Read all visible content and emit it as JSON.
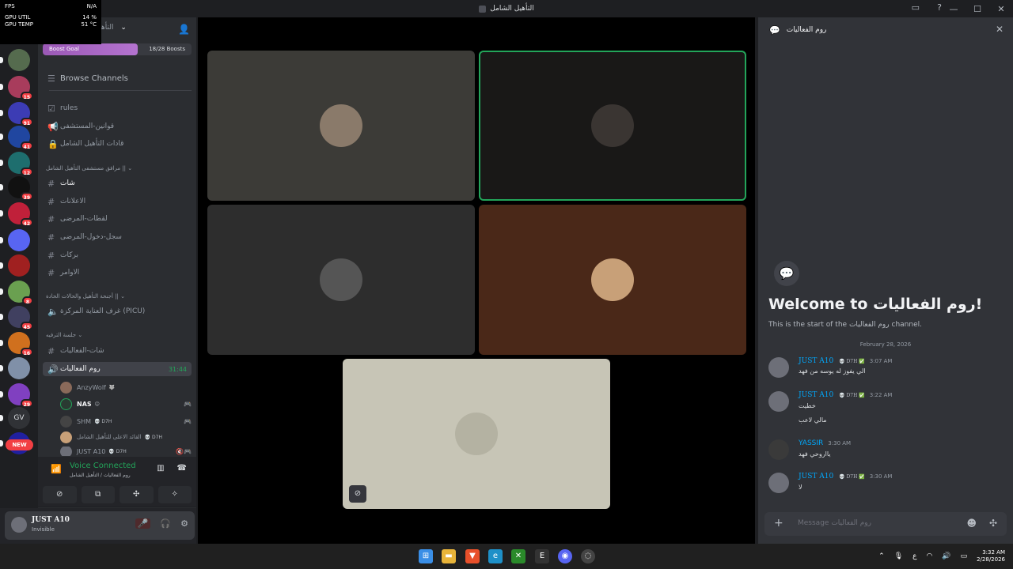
{
  "perf": {
    "fps_label": "FPS",
    "fps_value": "N/A",
    "gpu_util_label": "GPU UTIL",
    "gpu_util_value": "14 %",
    "gpu_temp_label": "GPU TEMP",
    "gpu_temp_value": "51 °C"
  },
  "window": {
    "title": "التأهيل الشامل"
  },
  "server": {
    "name": "التأهيل الشامل"
  },
  "boost": {
    "label": "Boost Goal",
    "count": "18/28 Boosts",
    "progress": 0.64
  },
  "sidebar": {
    "browse": "Browse Channels",
    "channels": [
      {
        "label": "rules"
      },
      {
        "label": "قوانين-المستشفى"
      },
      {
        "label": "قادات التأهيل الشامل"
      }
    ],
    "category1": "مرافق مستشفى التأهيل الشامل ||",
    "text_channels": [
      {
        "label": "شات"
      },
      {
        "label": "الاعلانات"
      },
      {
        "label": "لقطات-المرضى"
      },
      {
        "label": "سجل-دخول-المرضى"
      },
      {
        "label": "بركات"
      },
      {
        "label": "الاوامر"
      }
    ],
    "category2": "أجنحة التأهيل والحالات الحادة ||",
    "picu": "غرف العناية المركزة (PICU)",
    "category3": "جلسة الترفيه",
    "chat_events": "شات-الفعاليات",
    "voice_channel": {
      "label": "روم الفعاليات",
      "timer": "31:44"
    },
    "voice_users": [
      {
        "name": "AnzyWolf",
        "tag": "🐺",
        "right": ""
      },
      {
        "name": "NAS",
        "tag": "😊",
        "right": "🎮"
      },
      {
        "name": "SHM",
        "tag": "💀 D7H",
        "right": "🎮"
      },
      {
        "name": "القائد الاعلى للتأهيل الشامل",
        "tag": "💀 D7H",
        "right": ""
      },
      {
        "name": "JUST A10",
        "tag": "💀 D7H",
        "right": "🔇🎮"
      }
    ]
  },
  "servers": [
    {
      "badge": "",
      "color": "#556b4e"
    },
    {
      "badge": "15",
      "color": "#a83c5c"
    },
    {
      "badge": "91",
      "color": "#3c3cb4"
    },
    {
      "badge": "41",
      "color": "#2046a0"
    },
    {
      "badge": "12",
      "color": "#1e6e6e"
    },
    {
      "badge": "39",
      "color": "#111111"
    },
    {
      "badge": "42",
      "color": "#c0203a"
    },
    {
      "badge": "",
      "color": "#5865f2"
    },
    {
      "badge": "",
      "color": "#a02020"
    },
    {
      "badge": "8",
      "color": "#6aa050"
    },
    {
      "badge": "45",
      "color": "#404060"
    },
    {
      "badge": "16",
      "color": "#d0701e"
    },
    {
      "badge": "",
      "color": "#8090a8"
    },
    {
      "badge": "29",
      "color": "#8040c0"
    },
    {
      "badge": "",
      "color": "#303236"
    },
    {
      "badge": "",
      "color": "#2020a0"
    }
  ],
  "new_label": "NEW",
  "gv_label": "GV",
  "voice_panel": {
    "status": "Voice Connected",
    "channel": "روم الفعاليات / التأهيل الشامل"
  },
  "user": {
    "name": "JUST A10",
    "status": "Invisible"
  },
  "stage_tiles": [
    {
      "bg": "#3c3b37",
      "speaking": false,
      "avatar": "#8a7a6a"
    },
    {
      "bg": "#191817",
      "speaking": true,
      "avatar": "#3a3532"
    },
    {
      "bg": "#2d2d2d",
      "speaking": false,
      "avatar": "#555555"
    },
    {
      "bg": "#4a2818",
      "speaking": false,
      "avatar": "#c8a078"
    },
    {
      "bg": "#c7c5b6",
      "speaking": false,
      "avatar": "#b4b2a2"
    }
  ],
  "chat": {
    "header": "روم الفعاليات",
    "welcome_prefix": "Welcome to",
    "welcome_name": "روم الفعاليات!",
    "start_prefix": "This is the start of the",
    "start_channel": "روم الفعاليات",
    "start_suffix": "channel.",
    "date": "February 28, 2026",
    "messages": [
      {
        "author": "JUST A10",
        "tag": "💀 D7H ✅",
        "time": "3:07 AM",
        "lines": [
          "الي يفوز له يوسه من فهد"
        ]
      },
      {
        "author": "JUST A10",
        "tag": "💀 D7H ✅",
        "time": "3:22 AM",
        "lines": [
          "خطيت",
          "مالي لاعب"
        ]
      },
      {
        "author": "YASSIR",
        "tag": "",
        "time": "3:30 AM",
        "lines": [
          "يااروحي فهد"
        ]
      },
      {
        "author": "JUST A10",
        "tag": "💀 D7H ✅",
        "time": "3:30 AM",
        "lines": [
          "لا"
        ]
      }
    ],
    "placeholder": "Message روم الفعاليات"
  },
  "taskbar": {
    "lang": "ع",
    "time": "3:32 AM",
    "date": "2/28/2026"
  }
}
